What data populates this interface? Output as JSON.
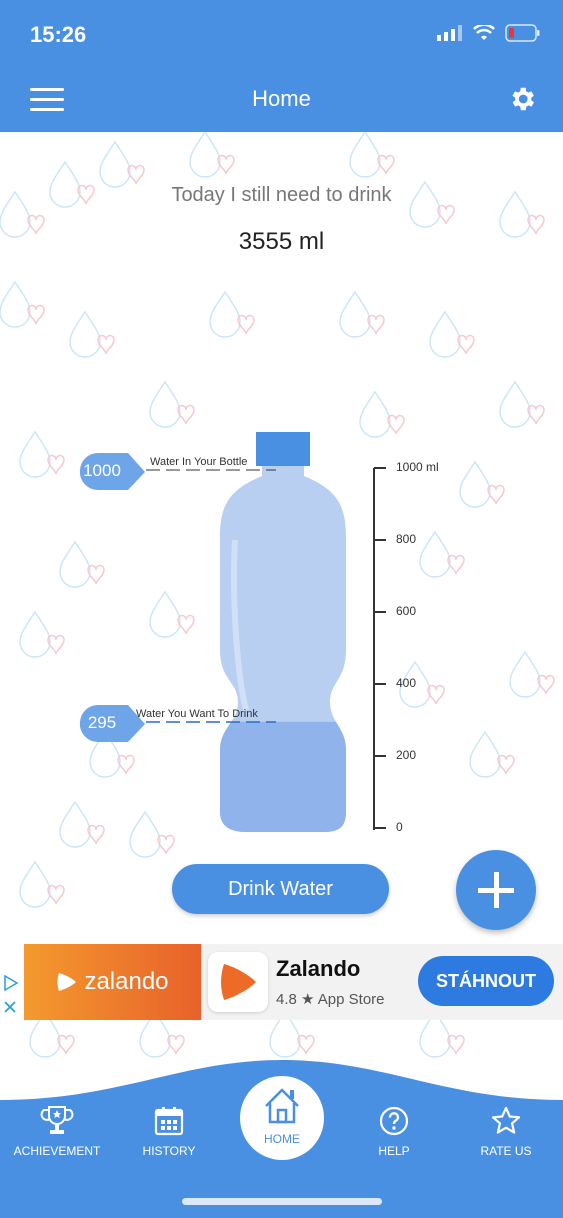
{
  "status": {
    "time": "15:26"
  },
  "header": {
    "title": "Home"
  },
  "summary": {
    "label": "Today I still need to drink",
    "value": "3555 ml"
  },
  "bottle": {
    "in_bottle_value": "1000",
    "in_bottle_caption": "Water In Your Bottle",
    "want_value": "295",
    "want_caption": "Water You Want To Drink",
    "fill_fraction": 0.295,
    "scale": [
      "1000 ml",
      "800",
      "600",
      "400",
      "200",
      "0"
    ]
  },
  "actions": {
    "drink_label": "Drink Water"
  },
  "ad": {
    "brand": "zalando",
    "name": "Zalando",
    "rating": "4.8 ★ App Store",
    "cta": "STÁHNOUT"
  },
  "nav": {
    "achievement": "ACHIEVEMENT",
    "history": "HISTORY",
    "home": "HOME",
    "help": "HELP",
    "rate": "RATE US"
  },
  "colors": {
    "primary": "#4a90e2",
    "bottle": "#b8cff2",
    "water": "#8fb3ea"
  }
}
